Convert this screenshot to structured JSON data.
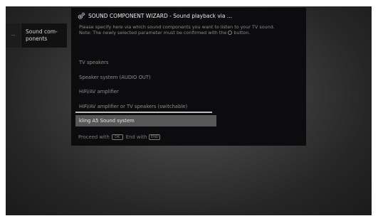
{
  "breadcrumb": {
    "prev": "...",
    "current": "Sound com-\nponents"
  },
  "wizard": {
    "icon": "gear-icon",
    "title": "SOUND COMPONENT WIZARD - Sound playback via ...",
    "description_line1": "Please specify here via which sound components you want to listen to your TV sound.",
    "description_line2_before": "Note: The newly selected parameter must be confirmed with the",
    "description_line2_after": "button.",
    "options": [
      {
        "label": "TV speakers"
      },
      {
        "label": "Speaker system (AUDIO OUT)"
      },
      {
        "label": "HiFi/AV amplifier"
      },
      {
        "label": "HiFi/AV amplifier or TV speakers (switchable)"
      },
      {
        "label": "kling A5 Sound system"
      }
    ],
    "selected_index": 4,
    "footer": {
      "proceed": "Proceed with",
      "proceed_key": "OK",
      "end": "End with",
      "end_key": "END"
    }
  },
  "colors": {
    "panel_bg": "#0c0c0e",
    "selection_bg": "#575757",
    "text_dim": "#8e8e8e",
    "text_bright": "#ececec"
  }
}
